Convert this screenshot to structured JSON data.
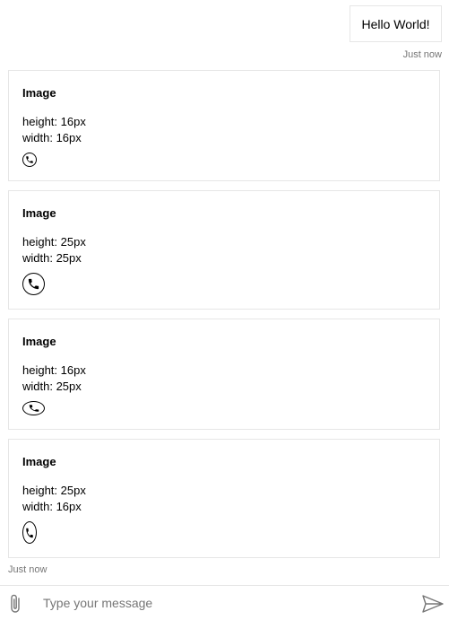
{
  "transcript": {
    "user_message": {
      "text": "Hello World!",
      "timestamp": "Just now"
    },
    "bot_activity": {
      "timestamp": "Just now",
      "cards": [
        {
          "title": "Image",
          "height_line": "height: 16px",
          "width_line": "width: 16px",
          "image_icon": "phone-icon"
        },
        {
          "title": "Image",
          "height_line": "height: 25px",
          "width_line": "width: 25px",
          "image_icon": "phone-icon"
        },
        {
          "title": "Image",
          "height_line": "height: 16px",
          "width_line": "width: 25px",
          "image_icon": "phone-icon"
        },
        {
          "title": "Image",
          "height_line": "height: 25px",
          "width_line": "width: 16px",
          "image_icon": "phone-icon"
        }
      ]
    }
  },
  "composer": {
    "placeholder": "Type your message",
    "attach_icon": "paperclip-icon",
    "send_icon": "send-icon"
  },
  "colors": {
    "border": "#e6e6e6",
    "timestamp": "#767676",
    "placeholder": "#767676"
  }
}
